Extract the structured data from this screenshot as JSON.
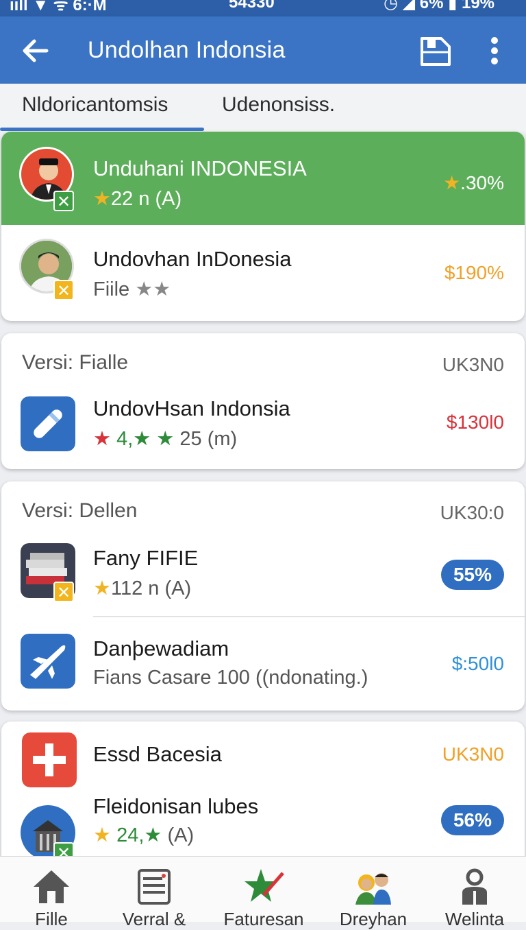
{
  "status_bar": {
    "left": "ııll ▼ ᯤ 6:·M",
    "center": "54330",
    "right": "◷ ◢ 6% ▮ 19%"
  },
  "app_bar": {
    "title": "Undolhan Indonsia"
  },
  "tabs": [
    {
      "label": "Nldoricantomsis"
    },
    {
      "label": "Udenonsiss."
    }
  ],
  "card1": {
    "rows": [
      {
        "name": "Unduhani INDONESIA",
        "sub": "22 n (A)",
        "right": ".30%"
      },
      {
        "name": "Undovhan InDonesia",
        "sub": "Fiile",
        "right": "$190%"
      }
    ]
  },
  "card2": {
    "section_label": "Versi:  Fialle",
    "section_right": "UK3N0",
    "row": {
      "name": "UndovHsan Indonsia",
      "rating": "4,",
      "sub": "25 (m)",
      "right": "$130l0"
    }
  },
  "card3": {
    "section_label": "Versi:  Dellen",
    "section_right": "UK30:0",
    "rows": [
      {
        "name": "Fany FIFIE",
        "sub": "112 n (A)",
        "pill": "55%"
      },
      {
        "name": "Danþewadiam",
        "sub": "Fians Casare 100 ((ndonating.)",
        "right": "$:50l0"
      }
    ]
  },
  "card4": {
    "rows": [
      {
        "name": "Essd Bacesia",
        "right": "UK3N0"
      },
      {
        "name": "Fleidonisan lubes",
        "rating": "24,",
        "sub": "(A)",
        "pill": "56%"
      }
    ]
  },
  "bottom_nav": [
    {
      "label": "Fille"
    },
    {
      "label": "Verral &"
    },
    {
      "label": "Faturesan"
    },
    {
      "label": "Dreyhan"
    },
    {
      "label": "Welinta"
    }
  ],
  "colors": {
    "primary": "#3b74c4",
    "green_row": "#5cae5a",
    "orange": "#f0a028",
    "red": "#d8333a",
    "blue_price": "#2f8fd8"
  }
}
